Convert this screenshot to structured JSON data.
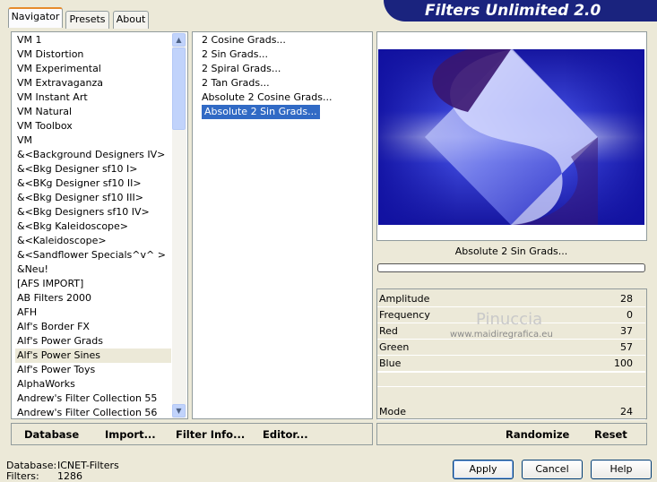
{
  "banner_title": "Filters Unlimited 2.0",
  "tabs": [
    "Navigator",
    "Presets",
    "About"
  ],
  "categories": [
    "VM 1",
    "VM Distortion",
    "VM Experimental",
    "VM Extravaganza",
    "VM Instant Art",
    "VM Natural",
    "VM Toolbox",
    "VM",
    "&<Background Designers IV>",
    "&<Bkg Designer sf10 I>",
    "&<BKg Designer sf10 II>",
    "&<Bkg Designer sf10 III>",
    "&<Bkg Designers sf10 IV>",
    "&<Bkg Kaleidoscope>",
    "&<Kaleidoscope>",
    "&<Sandflower Specials^v^ >",
    "&Neu!",
    "[AFS IMPORT]",
    "AB Filters 2000",
    "AFH",
    "Alf's Border FX",
    "Alf's Power Grads",
    "Alf's Power Sines",
    "Alf's Power Toys",
    "AlphaWorks",
    "Andrew's Filter Collection 55",
    "Andrew's Filter Collection 56"
  ],
  "selected_category": "Alf's Power Sines",
  "filters": [
    "2 Cosine Grads...",
    "2 Sin Grads...",
    "2 Spiral Grads...",
    "2 Tan Grads...",
    "Absolute 2 Cosine Grads...",
    "Absolute 2 Sin Grads..."
  ],
  "selected_filter": "Absolute 2 Sin Grads...",
  "preview_filter_name": "Absolute 2 Sin Grads...",
  "params": [
    {
      "name": "Amplitude",
      "value": "28"
    },
    {
      "name": "Frequency",
      "value": "0"
    },
    {
      "name": "Red",
      "value": "37"
    },
    {
      "name": "Green",
      "value": "57"
    },
    {
      "name": "Blue",
      "value": "100"
    }
  ],
  "mode": {
    "name": "Mode",
    "value": "24"
  },
  "watermark": {
    "line1": "Pinuccia",
    "line2": "www.maidiregrafica.eu"
  },
  "bottom_left_buttons": {
    "database": "Database",
    "import": "Import...",
    "filter_info": "Filter Info...",
    "editor": "Editor..."
  },
  "bottom_right_buttons": {
    "randomize": "Randomize",
    "reset": "Reset"
  },
  "status": {
    "database_label": "Database:",
    "database_value": "ICNET-Filters",
    "filters_label": "Filters:",
    "filters_value": "1286"
  },
  "dialog_buttons": {
    "apply": "Apply",
    "cancel": "Cancel",
    "help": "Help"
  },
  "colors": {
    "banner": "#1a237e",
    "selection": "#316ac5",
    "preview_blue": "#1a1aa8"
  }
}
